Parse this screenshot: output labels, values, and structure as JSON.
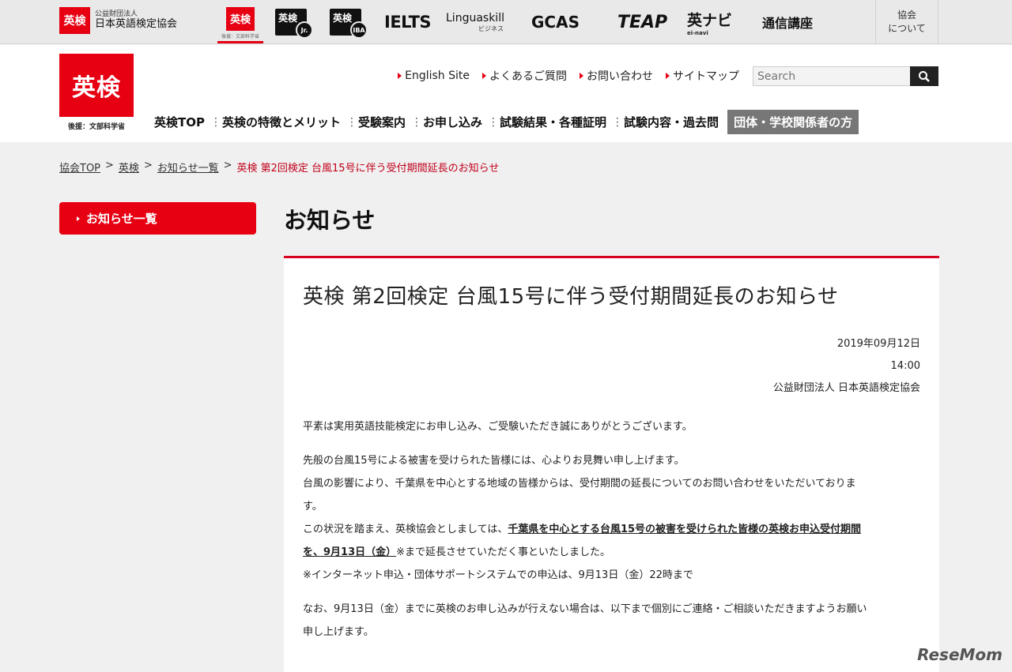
{
  "topbar": {
    "org_badge": "英検",
    "org_sub": "公益財団法人",
    "org_name": "日本英語検定協会",
    "brands": {
      "eiken": "英検",
      "eiken_tiny": "後援：文部科学省",
      "jr": "英検",
      "jr_badge": "Jr.",
      "iba": "英検",
      "iba_badge": "IBA",
      "ielts": "IELTS",
      "linguaskill": "Linguaskill",
      "linguaskill_sub": "ビジネス",
      "gcas": "GCAS",
      "teap": "TEAP",
      "eikennavi": "英ナビ",
      "eikennavi_sub": "ei-navi",
      "correspondence": "通信講座"
    },
    "about_line1": "協会",
    "about_line2": "について"
  },
  "header": {
    "logo_text": "英検",
    "logo_caption": "後援：文部科学省",
    "util_links": [
      "English Site",
      "よくあるご質問",
      "お問い合わせ",
      "サイトマップ"
    ],
    "search_placeholder": "Search",
    "nav": [
      "英検TOP",
      "英検の特徴とメリット",
      "受験案内",
      "お申し込み",
      "試験結果・各種証明",
      "試験内容・過去問"
    ],
    "nav_dark": "団体・学校関係者の方"
  },
  "breadcrumb": {
    "items": [
      "協会TOP",
      "英検",
      "お知らせ一覧"
    ],
    "current": "英検 第2回検定 台風15号に伴う受付期間延長のお知らせ"
  },
  "sidebar": {
    "button_label": "お知らせ一覧"
  },
  "main": {
    "heading": "お知らせ",
    "article": {
      "title": "英検 第2回検定 台風15号に伴う受付期間延長のお知らせ",
      "date": "2019年09月12日",
      "time": "14:00",
      "org": "公益財団法人 日本英語検定協会",
      "p1": "平素は実用英語技能検定にお申し込み、ご受験いただき誠にありがとうございます。",
      "p2_l1": "先般の台風15号による被害を受けられた皆様には、心よりお見舞い申し上げます。",
      "p2_l2": "台風の影響により、千葉県を中心とする地域の皆様からは、受付期間の延長についてのお問い合わせをいただいておりま",
      "p2_l3": "す。",
      "p2_l4_pre": "この状況を踏まえ、英検協会としましては、",
      "p2_l4_emph": "千葉県を中心とする台風15号の被害を受けられた皆様の英検お申込受付期間",
      "p2_l5_emph": "を、9月13日（金）",
      "p2_l5_post": "※まで延長させていただく事といたしました。",
      "p2_l6": "※インターネット申込・団体サポートシステムでの申込は、9月13日（金）22時まで",
      "p3_l1": "なお、9月13日（金）までに英検のお申し込みが行えない場合は、以下まで個別にご連絡・ご相談いただきますようお願い",
      "p3_l2": "申し上げます。"
    }
  },
  "watermark": "ReseMom"
}
